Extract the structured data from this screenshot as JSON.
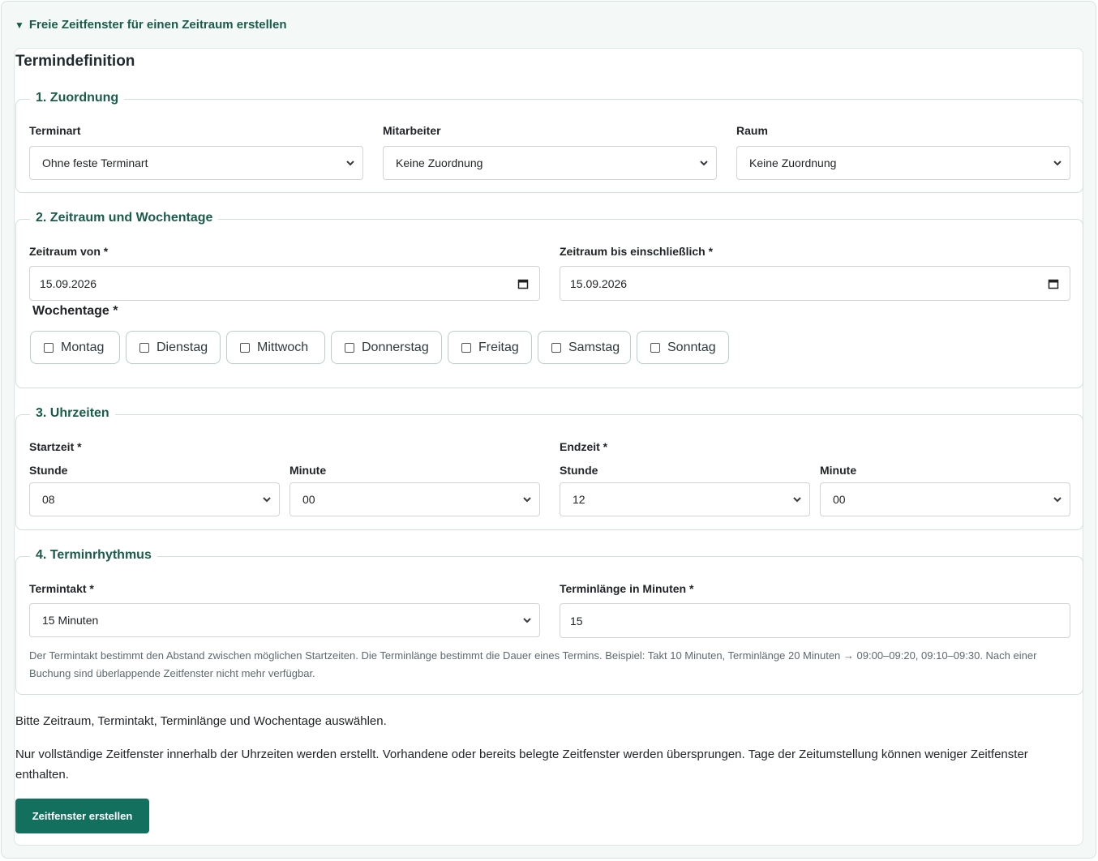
{
  "summary": {
    "label": "Freie Zeitfenster für einen Zeitraum erstellen"
  },
  "card": {
    "title": "Termindefinition"
  },
  "section1": {
    "legend": "1. Zuordnung",
    "terminart": {
      "label": "Terminart",
      "value": "Ohne feste Terminart"
    },
    "mitarbeiter": {
      "label": "Mitarbeiter",
      "value": "Keine Zuordnung"
    },
    "raum": {
      "label": "Raum",
      "value": "Keine Zuordnung"
    }
  },
  "section2": {
    "legend": "2. Zeitraum und Wochentage",
    "von": {
      "label": "Zeitraum von *",
      "value": "15.09.2026"
    },
    "bis": {
      "label": "Zeitraum bis einschließlich *",
      "value": "15.09.2026"
    },
    "wochentage_label": "Wochentage *",
    "days": [
      "Montag",
      "Dienstag",
      "Mittwoch",
      "Donnerstag",
      "Freitag",
      "Samstag",
      "Sonntag"
    ]
  },
  "section3": {
    "legend": "3. Uhrzeiten",
    "start_label": "Startzeit *",
    "end_label": "Endzeit *",
    "start_hour": {
      "label": "Stunde",
      "value": "08"
    },
    "start_minute": {
      "label": "Minute",
      "value": "00"
    },
    "end_hour": {
      "label": "Stunde",
      "value": "12"
    },
    "end_minute": {
      "label": "Minute",
      "value": "00"
    }
  },
  "section4": {
    "legend": "4. Terminrhythmus",
    "takt": {
      "label": "Termintakt *",
      "value": "15 Minuten"
    },
    "laenge": {
      "label": "Terminlänge in Minuten *",
      "value": "15"
    },
    "hint": "Der Termintakt bestimmt den Abstand zwischen möglichen Startzeiten. Die Terminlänge bestimmt die Dauer eines Termins. Beispiel: Takt 10 Minuten, Terminlänge 20 Minuten → 09:00–09:20, 09:10–09:30. Nach einer Buchung sind überlappende Zeitfenster nicht mehr verfügbar."
  },
  "status_text": "Bitte Zeitraum, Termintakt, Terminlänge und Wochentage auswählen.",
  "info_text": "Nur vollständige Zeitfenster innerhalb der Uhrzeiten werden erstellt. Vorhandene oder bereits belegte Zeitfenster werden übersprungen. Tage der Zeitumstellung können weniger Zeitfenster enthalten.",
  "submit_label": "Zeitfenster erstellen",
  "colors": {
    "accent": "#13705f",
    "heading": "#1a5c4a"
  }
}
